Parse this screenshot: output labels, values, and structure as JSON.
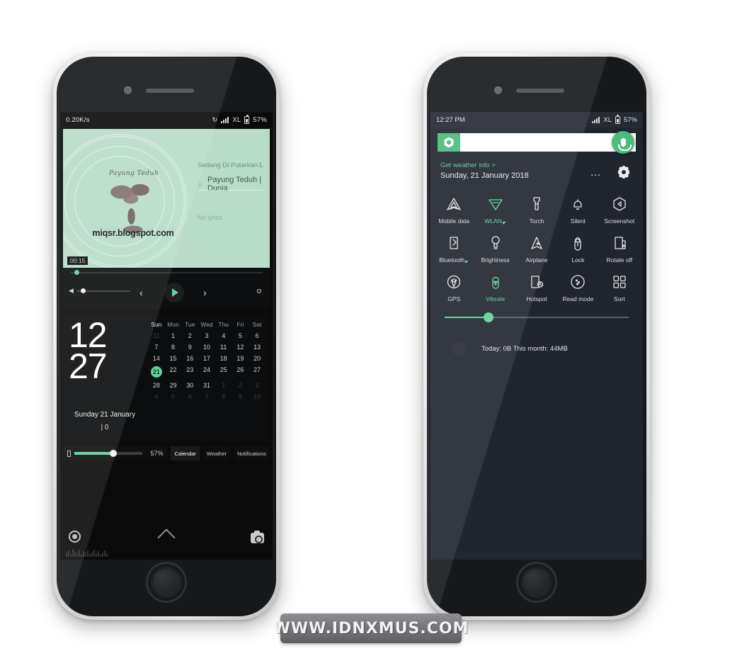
{
  "watermark": {
    "text": "WWW.IDNXMUS.COM"
  },
  "left_phone": {
    "status_bar": {
      "net_speed": "0.20K/s",
      "sync_icon": "sync-icon",
      "signal_icon": "signal-icon",
      "carrier": "XL",
      "battery_icon": "battery-icon",
      "battery_percent": "57%"
    },
    "music_widget": {
      "album_art": {
        "script_text": "Payung Teduh",
        "url_text": "miqsr.blogspot.com",
        "tree_icon": "tree-illustration",
        "background_color": "#b9dcc9"
      },
      "now_playing_label": "Sedang Di Putarkan",
      "now_playing_right": "1.",
      "track_prefix_icon": "note-icon",
      "track_title": "Payung Teduh | Dunia",
      "secondary_text": "No lyrics",
      "elapsed_time": "00:15",
      "seek_position_percent": 4,
      "volume_percent": 8,
      "controls": {
        "volume_icon": "volume-icon",
        "previous_icon": "previous-icon",
        "play_icon": "play-icon",
        "next_icon": "next-icon",
        "settings_icon": "settings-dot-icon"
      }
    },
    "calendar_widget": {
      "hour": "12",
      "minute": "27",
      "date_line": "Sunday 21 January",
      "note_line": "| 0",
      "day_headers": [
        "Sun",
        "Mon",
        "Tue",
        "Wed",
        "Thu",
        "Fri",
        "Sat"
      ],
      "weeks": [
        [
          {
            "d": "31",
            "s": "dim"
          },
          {
            "d": "1",
            "s": "on"
          },
          {
            "d": "2",
            "s": "on"
          },
          {
            "d": "3",
            "s": "on"
          },
          {
            "d": "4",
            "s": "on"
          },
          {
            "d": "5",
            "s": "on"
          },
          {
            "d": "6",
            "s": "on"
          }
        ],
        [
          {
            "d": "7",
            "s": "on"
          },
          {
            "d": "8",
            "s": "on"
          },
          {
            "d": "9",
            "s": "on"
          },
          {
            "d": "10",
            "s": "on"
          },
          {
            "d": "11",
            "s": "on"
          },
          {
            "d": "12",
            "s": "on"
          },
          {
            "d": "13",
            "s": "on"
          }
        ],
        [
          {
            "d": "14",
            "s": "on"
          },
          {
            "d": "15",
            "s": "on"
          },
          {
            "d": "16",
            "s": "on"
          },
          {
            "d": "17",
            "s": "on"
          },
          {
            "d": "18",
            "s": "on"
          },
          {
            "d": "19",
            "s": "on"
          },
          {
            "d": "20",
            "s": "on"
          }
        ],
        [
          {
            "d": "21",
            "s": "today"
          },
          {
            "d": "22",
            "s": "on"
          },
          {
            "d": "23",
            "s": "on"
          },
          {
            "d": "24",
            "s": "on"
          },
          {
            "d": "25",
            "s": "on"
          },
          {
            "d": "26",
            "s": "on"
          },
          {
            "d": "27",
            "s": "on"
          }
        ],
        [
          {
            "d": "28",
            "s": "on"
          },
          {
            "d": "29",
            "s": "on"
          },
          {
            "d": "30",
            "s": "on"
          },
          {
            "d": "31",
            "s": "on"
          },
          {
            "d": "1",
            "s": "dim"
          },
          {
            "d": "2",
            "s": "dim"
          },
          {
            "d": "3",
            "s": "dim"
          }
        ],
        [
          {
            "d": "4",
            "s": "dim"
          },
          {
            "d": "5",
            "s": "dim"
          },
          {
            "d": "6",
            "s": "dim"
          },
          {
            "d": "7",
            "s": "dim"
          },
          {
            "d": "8",
            "s": "dim"
          },
          {
            "d": "9",
            "s": "dim"
          },
          {
            "d": "10",
            "s": "dim"
          }
        ]
      ]
    },
    "battery_bar": {
      "battery_icon": "battery-icon",
      "percent_label": "57%",
      "fill_percent": 57
    },
    "tabs": [
      {
        "label": "Calendar",
        "active": true
      },
      {
        "label": "Weather",
        "active": false
      },
      {
        "label": "Notifications",
        "active": false
      }
    ],
    "lock_bottom": {
      "left_icon": "record-ring-icon",
      "center_icon": "chevron-up-icon",
      "right_icon": "camera-icon"
    }
  },
  "right_phone": {
    "status_bar": {
      "clock": "12:27 PM",
      "signal_icon": "signal-icon",
      "carrier": "XL",
      "battery_icon": "battery-icon",
      "battery_percent": "57%"
    },
    "search_bar": {
      "logo_icon": "google-hex-icon",
      "mic_icon": "microphone-icon",
      "value": "",
      "placeholder": ""
    },
    "header": {
      "weather_link": "Get weather info >",
      "date": "Sunday, 21 January 2018",
      "more_icon": "more-dots-icon",
      "settings_icon": "gear-icon"
    },
    "toggle_rows": [
      [
        {
          "label": "Mobile data",
          "icon": "mobile-data-icon",
          "active": false,
          "badge": false
        },
        {
          "label": "WLAN",
          "icon": "wlan-icon",
          "active": true,
          "badge": true
        },
        {
          "label": "Torch",
          "icon": "torch-icon",
          "active": false,
          "badge": false
        },
        {
          "label": "Silent",
          "icon": "silent-bell-icon",
          "active": false,
          "badge": false
        },
        {
          "label": "Screenshot",
          "icon": "screenshot-icon",
          "active": false,
          "badge": false
        }
      ],
      [
        {
          "label": "Bluetooth",
          "icon": "bluetooth-icon",
          "active": false,
          "badge": true
        },
        {
          "label": "Brightness",
          "icon": "brightness-bulb-icon",
          "active": false,
          "badge": false
        },
        {
          "label": "Airplane",
          "icon": "airplane-icon",
          "active": false,
          "badge": false
        },
        {
          "label": "Lock",
          "icon": "lock-icon",
          "active": false,
          "badge": false
        },
        {
          "label": "Rotate off",
          "icon": "rotate-off-icon",
          "active": false,
          "badge": false
        }
      ],
      [
        {
          "label": "GPS",
          "icon": "gps-pin-icon",
          "active": false,
          "badge": false
        },
        {
          "label": "Vibrate",
          "icon": "vibrate-icon",
          "active": true,
          "badge": false
        },
        {
          "label": "Hotspot",
          "icon": "hotspot-icon",
          "active": false,
          "badge": false
        },
        {
          "label": "Read mode",
          "icon": "read-mode-icon",
          "active": false,
          "badge": false
        },
        {
          "label": "Sort",
          "icon": "sort-grid-icon",
          "active": false,
          "badge": false
        }
      ]
    ],
    "brightness_slider": {
      "value_percent": 24
    },
    "data_usage": {
      "text": "Today: 0B   This month: 44MB",
      "icon": "data-usage-icon"
    }
  },
  "colors": {
    "accent_green": "#5fd39a",
    "search_green": "#4cbb7f",
    "album_mint": "#b9dcc9",
    "shade_bg": "#21252e",
    "lock_bg": "#0b0b0c"
  }
}
